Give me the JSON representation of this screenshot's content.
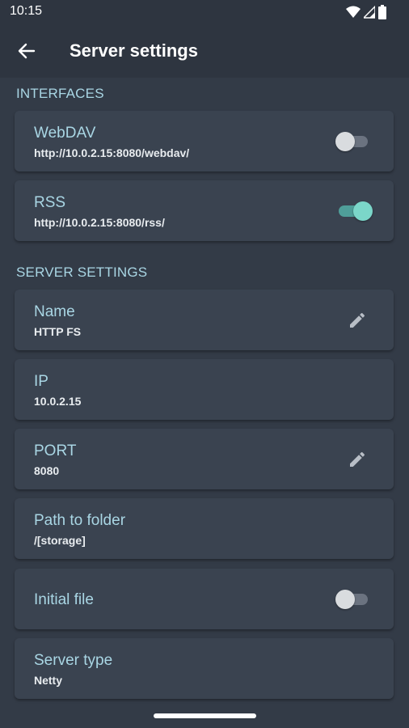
{
  "status_bar": {
    "time": "10:15"
  },
  "app_bar": {
    "title": "Server settings"
  },
  "sections": {
    "interfaces": "INTERFACES",
    "server_settings": "SERVER SETTINGS"
  },
  "interfaces": {
    "webdav": {
      "title": "WebDAV",
      "url": "http://10.0.2.15:8080/webdav/",
      "enabled": false
    },
    "rss": {
      "title": "RSS",
      "url": "http://10.0.2.15:8080/rss/",
      "enabled": true
    }
  },
  "settings": {
    "name": {
      "title": "Name",
      "value": "HTTP FS"
    },
    "ip": {
      "title": "IP",
      "value": "10.0.2.15"
    },
    "port": {
      "title": "PORT",
      "value": "8080"
    },
    "path": {
      "title": "Path to folder",
      "value": "/[storage]"
    },
    "initial_file": {
      "title": "Initial file",
      "enabled": false
    },
    "server_type": {
      "title": "Server type",
      "value": "Netty"
    }
  },
  "colors": {
    "background": "#333b47",
    "card": "#3a4350",
    "accent": "#a9d6e4",
    "toggle_on": "#7bd6c9"
  }
}
